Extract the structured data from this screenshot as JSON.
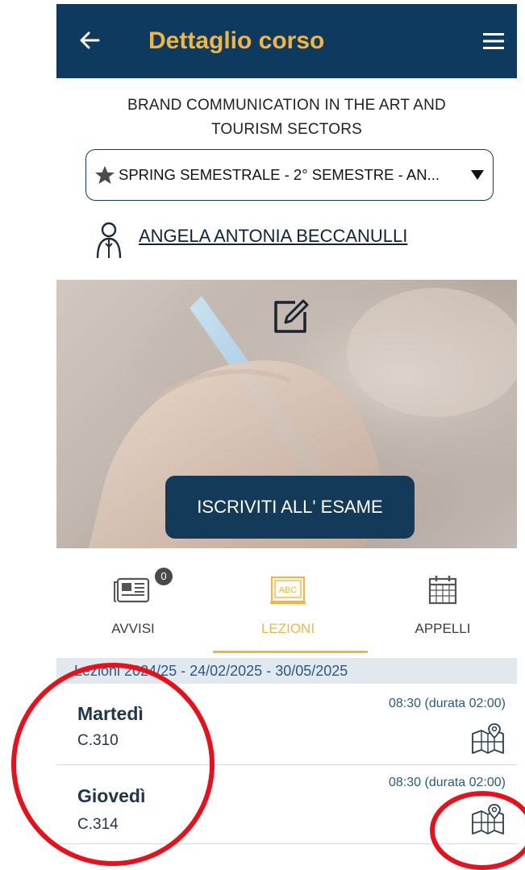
{
  "header": {
    "title": "Dettaglio corso",
    "back_icon": "arrow-left-icon",
    "menu_icon": "hamburger-menu-icon"
  },
  "course": {
    "title_line1": "BRAND COMMUNICATION IN THE ART AND",
    "title_line2": "TOURISM SECTORS"
  },
  "semester": {
    "selected": "SPRING SEMESTRALE - 2° SEMESTRE - AN...",
    "icon": "star-icon"
  },
  "teacher": {
    "name": "ANGELA ANTONIA BECCANULLI",
    "icon": "teacher-icon"
  },
  "hero": {
    "button_label": "ISCRIVITI ALL' ESAME",
    "edit_icon": "edit-icon"
  },
  "tabs": [
    {
      "label": "AVVISI",
      "icon": "newspaper-icon",
      "badge": "0"
    },
    {
      "label": "LEZIONI",
      "icon": "blackboard-icon",
      "active": true
    },
    {
      "label": "APPELLI",
      "icon": "calendar-icon"
    }
  ],
  "lessons": {
    "period": "Lezioni 2024/25 - 24/02/2025 - 30/05/2025",
    "items": [
      {
        "day": "Martedì",
        "room": "C.310",
        "time": "08:30 (durata 02:00)"
      },
      {
        "day": "Giovedì",
        "room": "C.314",
        "time": "08:30 (durata 02:00)"
      }
    ]
  },
  "colors": {
    "header_bg": "#0f3a5f",
    "accent": "#f2b640",
    "annotation": "#e8111b"
  }
}
